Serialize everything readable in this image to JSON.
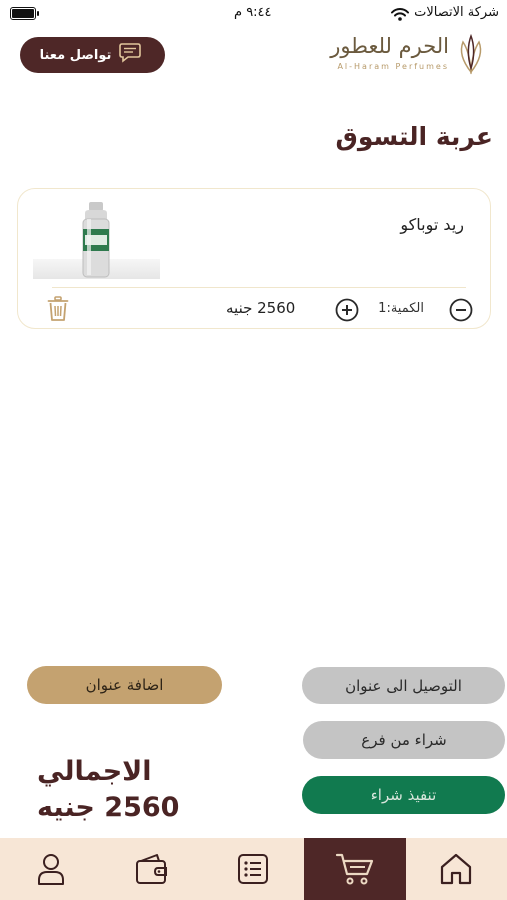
{
  "status_bar": {
    "carrier": "شركة الاتصالات",
    "time": "٩:٤٤ م"
  },
  "header": {
    "contact_button": "تواصل معنا",
    "logo_ar": "الحرم للعطور",
    "logo_en": "Al-Haram Perfumes"
  },
  "page": {
    "title": "عربة التسوق"
  },
  "cart": {
    "items": [
      {
        "name": "ريد توباكو",
        "quantity_label": "الكمية:1",
        "price": "2560 جنيه"
      }
    ]
  },
  "actions": {
    "add_address": "اضافة عنوان",
    "deliver_to_address": "التوصيل الى عنوان",
    "buy_from_branch": "شراء من فرع",
    "checkout": "تنفيذ شراء"
  },
  "summary": {
    "total_label": "الاجمالي",
    "total_value": "2560 جنيه"
  },
  "colors": {
    "brand_dark": "#4e2727",
    "gold": "#c4a270",
    "green": "#117a4f",
    "gray": "#c4c4c4",
    "nav_bg": "#f7e6d6"
  },
  "nav": {
    "items": [
      "home-icon",
      "cart-icon",
      "list-icon",
      "wallet-icon",
      "user-icon"
    ],
    "active": "cart-icon"
  }
}
